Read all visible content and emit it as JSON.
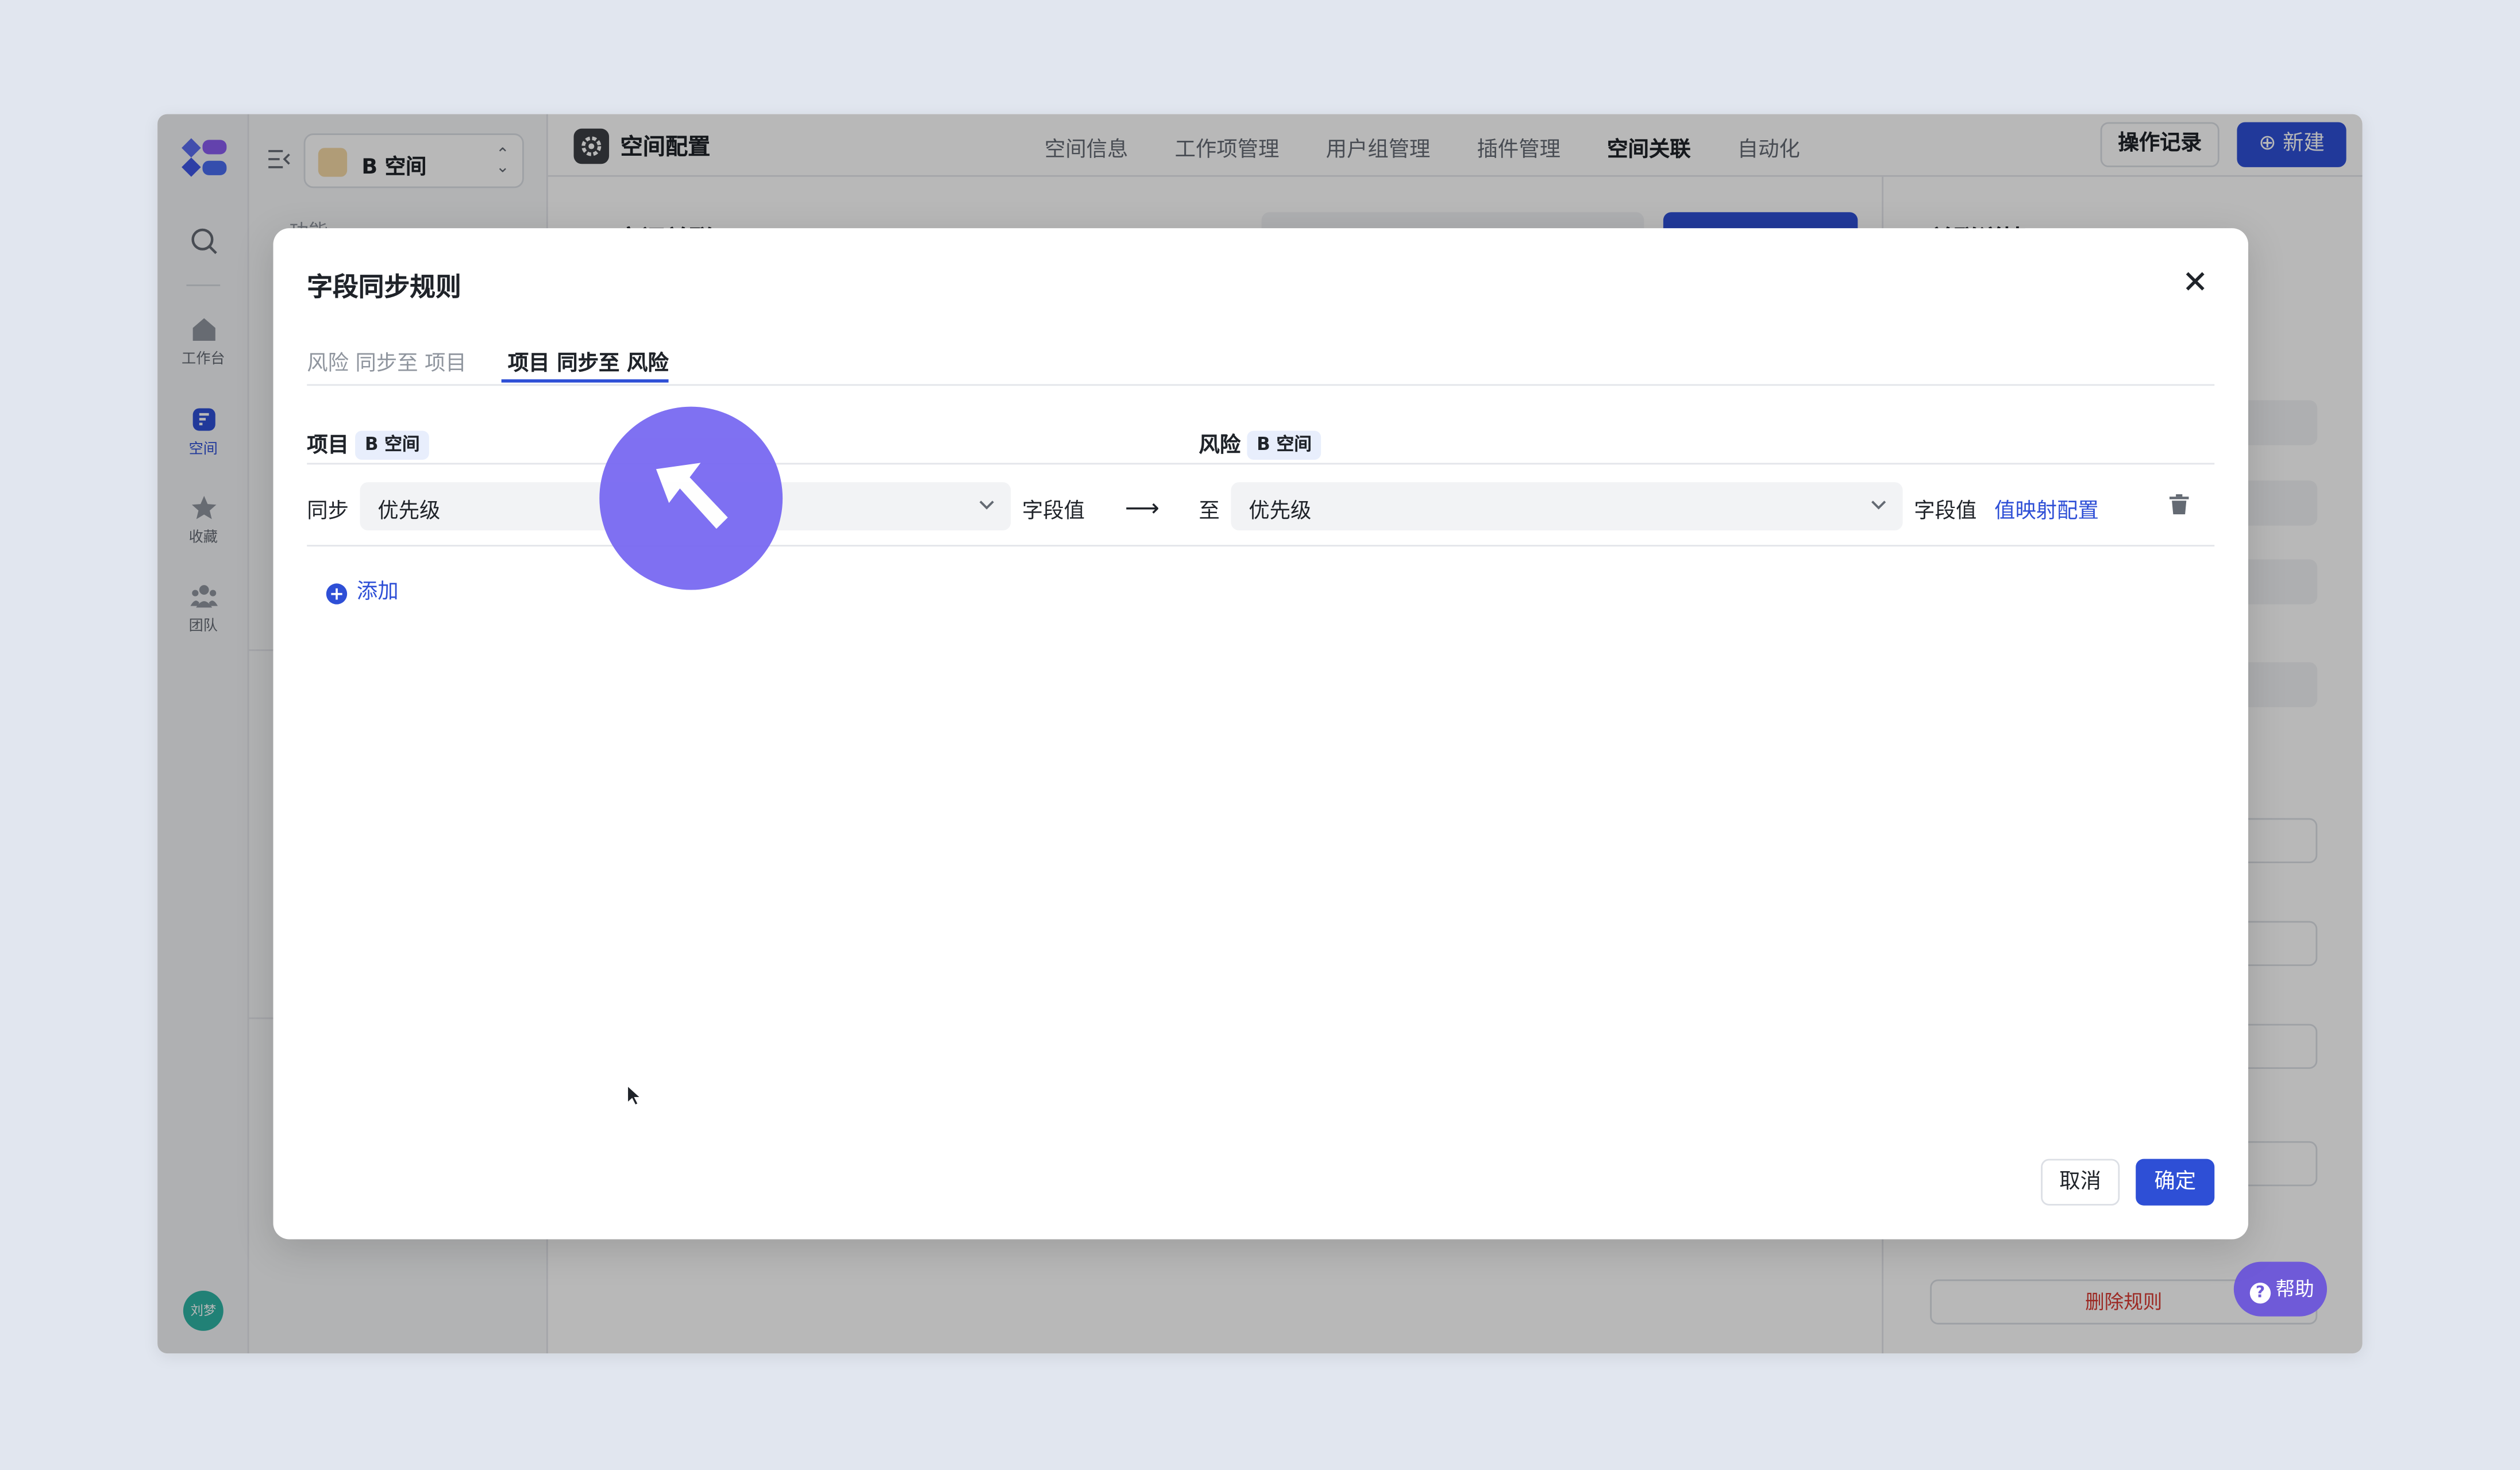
{
  "app": {
    "space_name": "B 空间",
    "nav_section": "功能",
    "rail": {
      "workbench": "工作台",
      "space": "空间",
      "favorites": "收藏",
      "team": "团队",
      "user_avatar": "刘梦"
    },
    "topbar": {
      "title": "空间配置",
      "tabs": [
        {
          "label": "空间信息",
          "active": false
        },
        {
          "label": "工作项管理",
          "active": false
        },
        {
          "label": "用户组管理",
          "active": false
        },
        {
          "label": "插件管理",
          "active": false
        },
        {
          "label": "空间关联",
          "active": true
        },
        {
          "label": "自动化",
          "active": false
        }
      ],
      "log_button": "操作记录",
      "new_button": "新建"
    },
    "content_title": "空间关联",
    "side_title": "关联详情",
    "side_delete": "删除规则",
    "help": "帮助"
  },
  "modal": {
    "title": "字段同步规则",
    "tabs": [
      {
        "label": "风险 同步至 项目",
        "active": false
      },
      {
        "label": "项目 同步至 风险",
        "active": true
      }
    ],
    "source": {
      "label": "项目",
      "space_tag": "B 空间"
    },
    "target": {
      "label": "风险",
      "space_tag": "B 空间"
    },
    "row": {
      "sync_label": "同步",
      "source_field": "优先级",
      "source_value_label": "字段值",
      "arrow": "⟶",
      "to_label": "至",
      "target_field": "优先级",
      "target_value_label": "字段值",
      "mapping_link": "值映射配置"
    },
    "add_label": "添加",
    "cancel": "取消",
    "confirm": "确定"
  },
  "colors": {
    "accent": "#2e4fd6",
    "click_indicator": "#7b6cf2",
    "help": "#6f5ad8"
  }
}
